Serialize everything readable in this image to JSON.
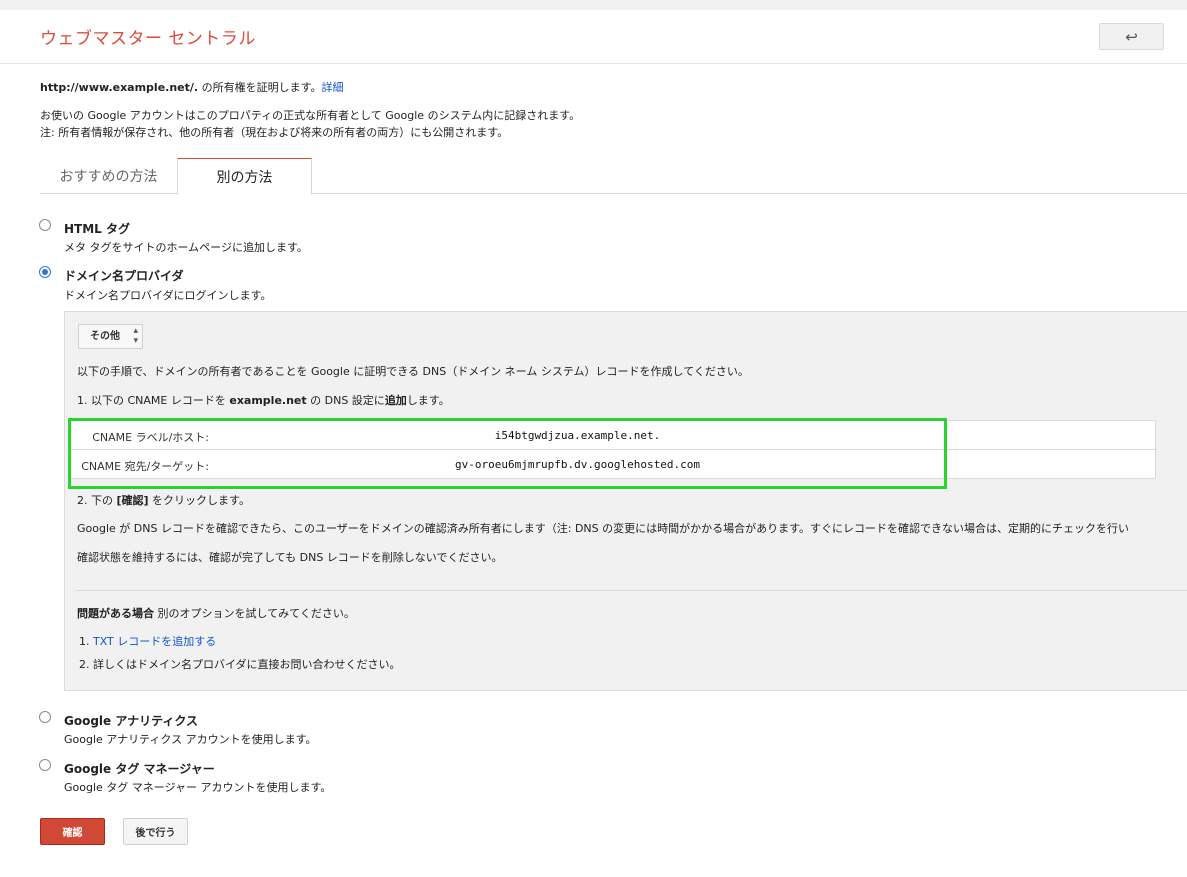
{
  "header": {
    "title": "ウェブマスター セントラル",
    "back_icon": "↩"
  },
  "ownership": {
    "url": "http://www.example.net/.",
    "text": " の所有権を証明します。",
    "details_link": "詳細"
  },
  "notice": {
    "line1": "お使いの Google アカウントはこのプロパティの正式な所有者として Google のシステム内に記録されます。",
    "line2": "注: 所有者情報が保存され、他の所有者（現在および将来の所有者の両方）にも公開されます。"
  },
  "tabs": [
    {
      "label": "おすすめの方法"
    },
    {
      "label": "別の方法"
    }
  ],
  "options": {
    "html_tag": {
      "title": "HTML タグ",
      "desc": "メタ タグをサイトのホームページに追加します。"
    },
    "domain_provider": {
      "title": "ドメイン名プロバイダ",
      "desc": "ドメイン名プロバイダにログインします。"
    },
    "analytics": {
      "title": "Google アナリティクス",
      "desc": "Google アナリティクス アカウントを使用します。"
    },
    "tag_manager": {
      "title": "Google タグ マネージャー",
      "desc": "Google タグ マネージャー アカウントを使用します。"
    }
  },
  "provider_panel": {
    "select_value": "その他",
    "instruction": "以下の手順で、ドメインの所有者であることを Google に証明できる DNS（ドメイン ネーム システム）レコードを作成してください。",
    "step1": {
      "prefix": "1. 以下の CNAME レコードを ",
      "domain": "example.net",
      "middle": " の DNS 設定に",
      "emph": "追加",
      "suffix": "します。"
    },
    "records": [
      {
        "label": "CNAME ラベル/ホスト:",
        "value": "i54btgwdjzua.example.net."
      },
      {
        "label": "CNAME 宛先/ターゲット:",
        "value": "gv-oroeu6mjmrupfb.dv.googlehosted.com"
      }
    ],
    "step2": {
      "prefix": "2. 下の ",
      "emph": "[確認]",
      "suffix": " をクリックします。"
    },
    "para1": "Google が DNS レコードを確認できたら、このユーザーをドメインの確認済み所有者にします（注: DNS の変更には時間がかかる場合があります。すぐにレコードを確認できない場合は、定期的にチェックを行い",
    "para2": "確認状態を維持するには、確認が完了しても DNS レコードを削除しないでください。",
    "problem": {
      "bold": "問題がある場合",
      "rest": " 別のオプションを試してみてください。"
    },
    "alt1": {
      "num": "1. ",
      "link": "TXT レコードを追加する"
    },
    "alt2": "2. 詳しくはドメイン名プロバイダに直接お問い合わせください。"
  },
  "buttons": {
    "confirm": "確認",
    "later": "後で行う"
  },
  "colors": {
    "title_red": "#dd4b39",
    "link_blue": "#1155cc",
    "confirm_red": "#d14836",
    "highlight_green": "#28d52e"
  }
}
